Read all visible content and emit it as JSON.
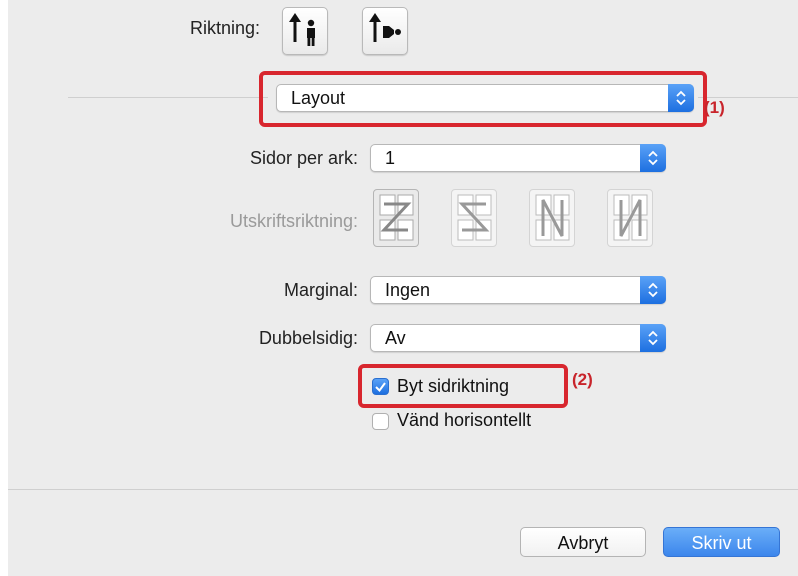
{
  "orientation": {
    "label": "Riktning:",
    "options": [
      "portrait-icon",
      "landscape-icon"
    ]
  },
  "section_select": {
    "value": "Layout",
    "marker": "(1)"
  },
  "pages_per_sheet": {
    "label": "Sidor per ark:",
    "value": "1"
  },
  "print_direction": {
    "label": "Utskriftsriktning:",
    "options": [
      "direction-z-icon",
      "direction-reverse-z-icon",
      "direction-n-icon",
      "direction-reverse-n-icon"
    ]
  },
  "margin": {
    "label": "Marginal:",
    "value": "Ingen"
  },
  "duplex": {
    "label": "Dubbelsidig:",
    "value": "Av"
  },
  "checkboxes": [
    {
      "label": "Byt sidriktning",
      "checked": true
    },
    {
      "label": "Vänd horisontellt",
      "checked": false
    }
  ],
  "checkbox_marker": "(2)",
  "buttons": {
    "cancel": "Avbryt",
    "print": "Skriv ut"
  },
  "colors": {
    "accent": "#2f7ff0",
    "highlight": "#d8262e",
    "panel": "#ececec"
  }
}
